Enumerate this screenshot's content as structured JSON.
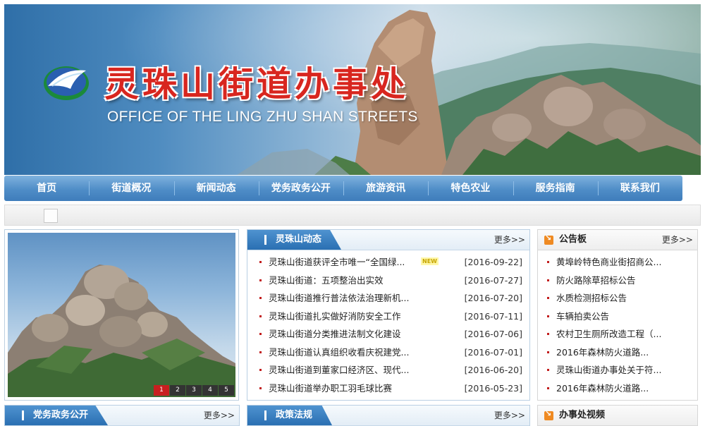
{
  "header": {
    "title": "灵珠山街道办事处",
    "subtitle": "OFFICE OF THE LING ZHU SHAN STREETS"
  },
  "nav": [
    "首页",
    "街道概况",
    "新闻动态",
    "党务政务公开",
    "旅游资讯",
    "特色农业",
    "服务指南",
    "联系我们"
  ],
  "slider": {
    "pages": [
      "1",
      "2",
      "3",
      "4",
      "5"
    ],
    "active": "1"
  },
  "news_panel": {
    "title": "灵珠山动态",
    "more": "更多>>",
    "new_badge": "NEW",
    "items": [
      {
        "text": "灵珠山街道获评全市唯一“全国绿...",
        "date": "[2016-09-22]",
        "is_new": true
      },
      {
        "text": "灵珠山街道：五项整治出实效",
        "date": "[2016-07-27]"
      },
      {
        "text": "灵珠山街道推行普法依法治理新机...",
        "date": "[2016-07-20]"
      },
      {
        "text": "灵珠山街道扎实做好消防安全工作",
        "date": "[2016-07-11]"
      },
      {
        "text": "灵珠山街道分类推进法制文化建设",
        "date": "[2016-07-06]"
      },
      {
        "text": "灵珠山街道认真组织收看庆祝建党...",
        "date": "[2016-07-01]"
      },
      {
        "text": "灵珠山街道到董家口经济区、现代...",
        "date": "[2016-06-20]"
      },
      {
        "text": "灵珠山街道举办职工羽毛球比赛",
        "date": "[2016-05-23]"
      }
    ]
  },
  "notice_panel": {
    "title": "公告板",
    "more": "更多>>",
    "items": [
      "黄埠岭特色商业街招商公...",
      "防火路除草招标公告",
      "水质检测招标公告",
      "车辆拍卖公告",
      "农村卫生厕所改造工程（...",
      "2016年森林防火道路...",
      "灵珠山街道办事处关于符...",
      "2016年森林防火道路..."
    ]
  },
  "bottom_panels": [
    {
      "title": "党务政务公开",
      "more": "更多>>"
    },
    {
      "title": "政策法规",
      "more": "更多>>"
    },
    {
      "title": "办事处视频"
    }
  ],
  "colors": {
    "nav": "#4f8dc7",
    "title_red": "#d8261f",
    "accent_orange": "#ef8a22"
  }
}
